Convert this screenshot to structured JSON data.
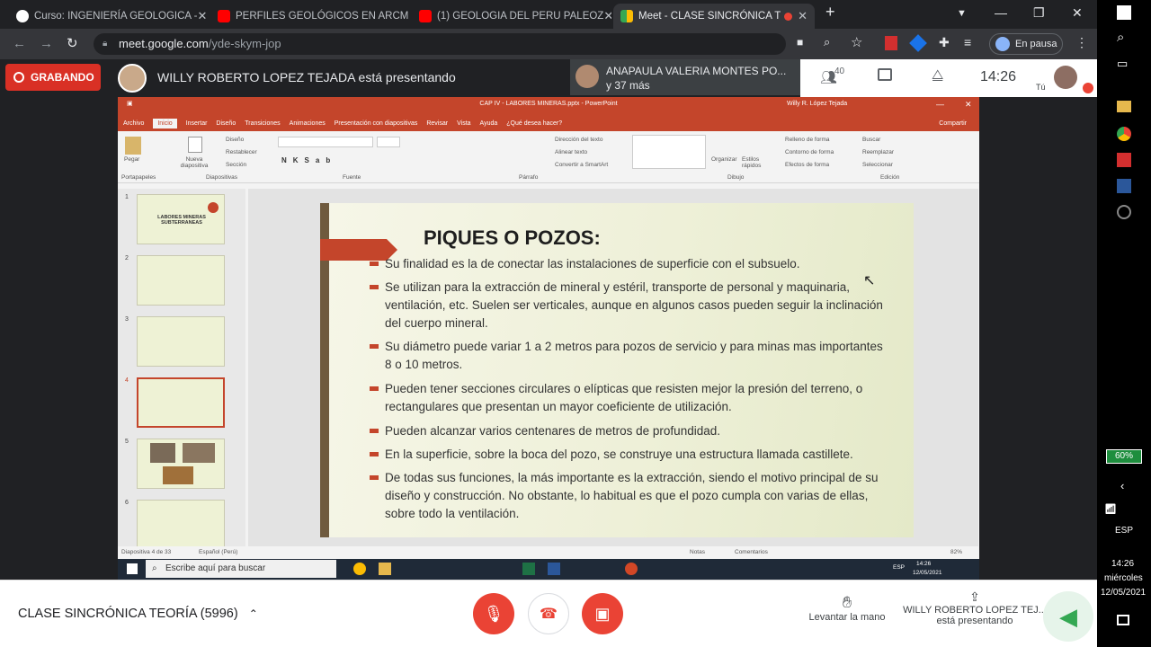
{
  "browser": {
    "tabs": [
      {
        "title": "Curso: INGENIERÍA GEOLOGICA -",
        "icon": "moodle-icon",
        "active": false
      },
      {
        "title": "PERFILES GEOLÓGICOS EN ARCM",
        "icon": "youtube-icon",
        "active": false
      },
      {
        "title": "(1) GEOLOGIA DEL PERU PALEOZ",
        "icon": "youtube-icon",
        "active": false
      },
      {
        "title": "Meet - CLASE SINCRÓNICA T",
        "icon": "meet-icon",
        "active": true
      }
    ],
    "url_host": "meet.google.com",
    "url_path": "/yde-skym-jop",
    "profile_label": "En pausa"
  },
  "meet_top": {
    "recording_label": "GRABANDO",
    "presenting_text": "WILLY ROBERTO LOPEZ TEJADA está presentando",
    "notify_name": "ANAPAULA VALERIA MONTES PO...",
    "notify_more": "y 37 más",
    "participants_count": "40",
    "clock": "14:26",
    "self_label": "Tú"
  },
  "powerpoint": {
    "window_title": "CAP IV - LABORES MINERAS.pptx  -  PowerPoint",
    "user": "Willy R. López Tejada",
    "menu": [
      "Archivo",
      "Inicio",
      "Insertar",
      "Diseño",
      "Transiciones",
      "Animaciones",
      "Presentación con diapositivas",
      "Revisar",
      "Vista",
      "Ayuda",
      "¿Qué desea hacer?"
    ],
    "share_label": "Compartir",
    "ribbon_groups": [
      "Portapapeles",
      "Diapositivas",
      "Fuente",
      "Párrafo",
      "Dibujo",
      "Edición"
    ],
    "ribbon_buttons": {
      "paste": "Pegar",
      "new_slide": "Nueva diapositiva",
      "layout": "Diseño",
      "reset": "Restablecer",
      "section": "Sección",
      "text_direction": "Dirección del texto",
      "align_text": "Alinear texto",
      "smartart": "Convertir a SmartArt",
      "arrange": "Organizar",
      "quick_styles": "Estilos rápidos",
      "shape_fill": "Relleno de forma",
      "shape_outline": "Contorno de forma",
      "shape_effects": "Efectos de forma",
      "find": "Buscar",
      "replace": "Reemplazar",
      "select": "Seleccionar"
    },
    "thumb_numbers": [
      "1",
      "2",
      "3",
      "4",
      "5",
      "6"
    ],
    "thumb1_title": "LABORES MINERAS SUBTERRANEAS",
    "slide": {
      "title": "PIQUES O POZOS:",
      "bullets": [
        "Su finalidad es la de conectar las instalaciones de superficie con el subsuelo.",
        "Se utilizan para la extracción de mineral y estéril, transporte de personal y maquinaria, ventilación, etc. Suelen ser verticales, aunque en algunos casos pueden seguir la inclinación del cuerpo mineral.",
        "Su diámetro puede variar 1 a 2 metros para pozos de servicio y para minas mas importantes 8 o 10 metros.",
        "Pueden tener secciones circulares o elípticas que resisten mejor la presión del terreno, o rectangulares que presentan un mayor coeficiente de utilización.",
        "Pueden alcanzar varios centenares de metros de profundidad.",
        "En la superficie, sobre la boca del pozo, se construye una estructura llamada castillete.",
        "De todas sus funciones, la más importante es la extracción, siendo el motivo principal de su diseño y construcción. No obstante, lo habitual es que el pozo cumpla con varias de ellas, sobre todo la ventilación."
      ]
    },
    "status_slide": "Diapositiva 4 de 33",
    "status_lang": "Español (Perú)",
    "status_notes": "Notas",
    "status_comments": "Comentarios",
    "zoom": "82%",
    "taskbar_search": "Escribe aquí para buscar",
    "taskbar_lang": "ESP",
    "taskbar_time": "14:26",
    "taskbar_date": "12/05/2021"
  },
  "meet_bottom": {
    "meeting_name": "CLASE SINCRÓNICA TEORÍA (5996)",
    "raise_hand": "Levantar la mano",
    "presenter_line1": "WILLY ROBERTO LOPEZ TEJ...",
    "presenter_line2": "está presentando"
  },
  "windows_tray": {
    "battery": "60%",
    "lang": "ESP",
    "time": "14:26",
    "day": "miércoles",
    "date": "12/05/2021"
  }
}
